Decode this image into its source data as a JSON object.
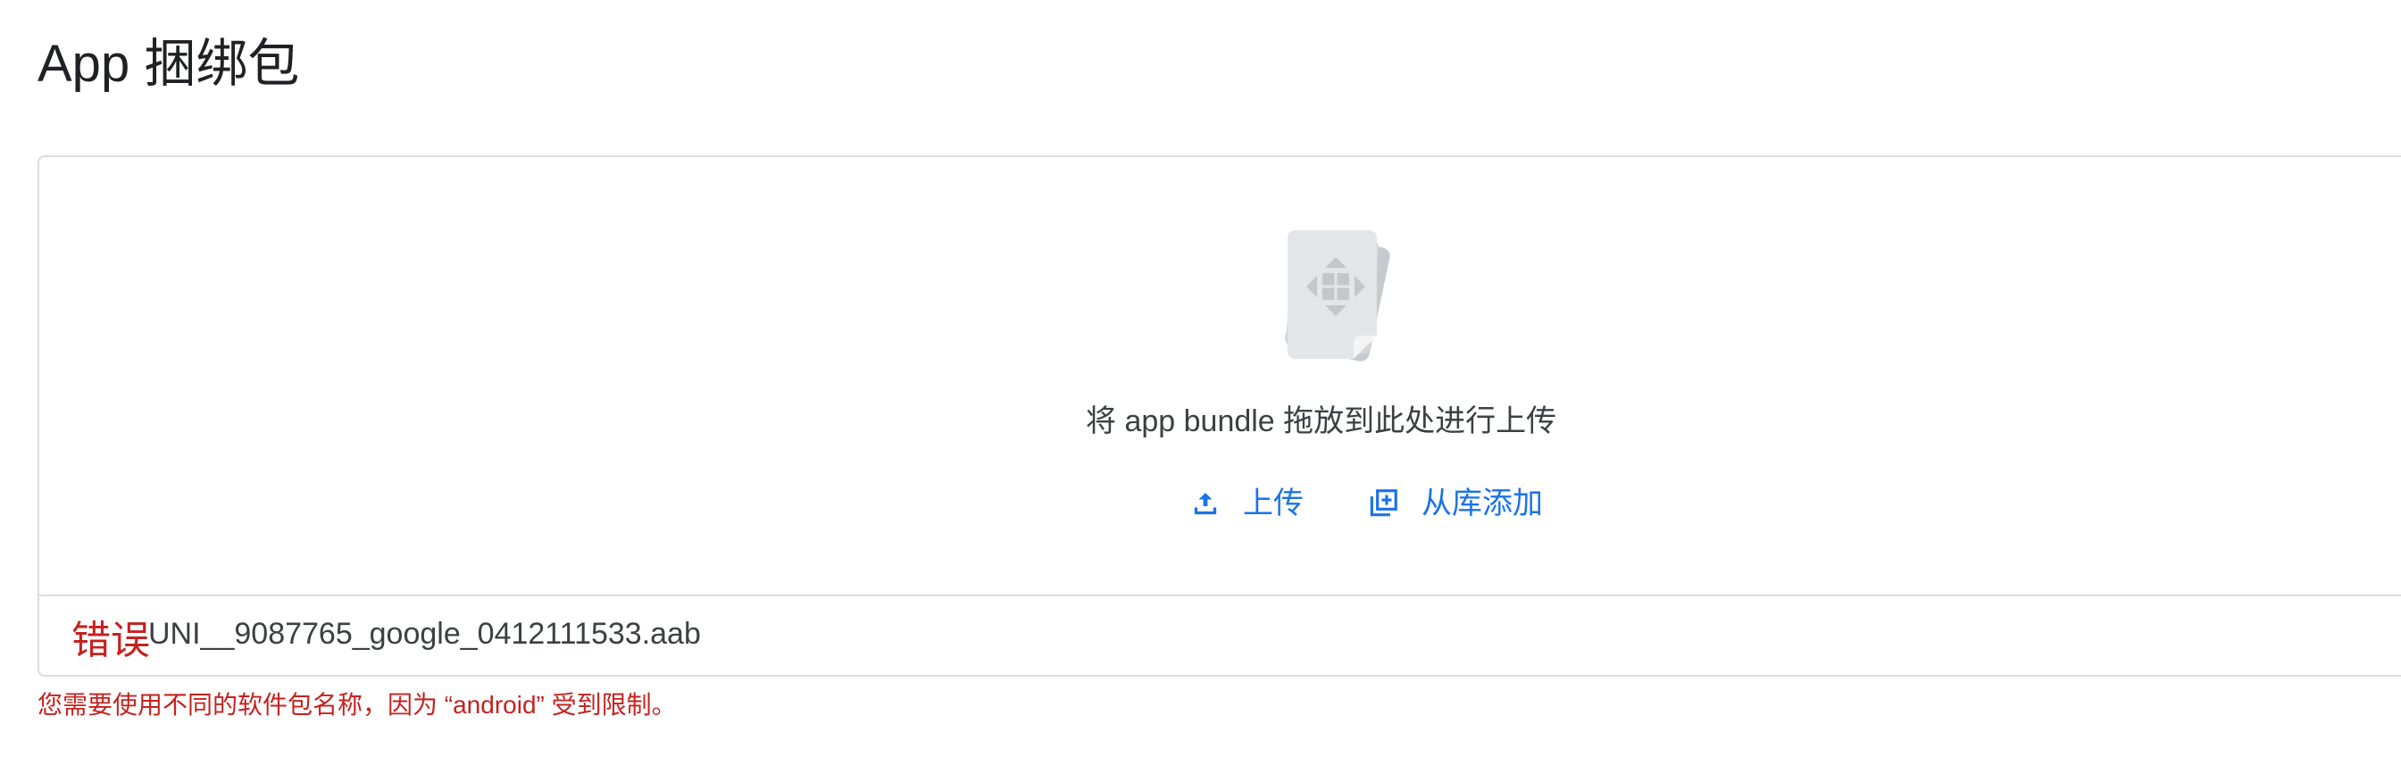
{
  "page": {
    "title": "App 捆绑包"
  },
  "dropzone": {
    "icon": "app-bundle-icon",
    "hint": "将 app bundle 拖放到此处进行上传",
    "actions": [
      {
        "label": "上传",
        "icon": "upload-icon"
      },
      {
        "label": "从库添加",
        "icon": "add-from-library-icon"
      }
    ]
  },
  "file": {
    "status_label": "错误",
    "name": "UNI__9087765_google_0412111533.aab"
  },
  "error": {
    "message": "您需要使用不同的软件包名称，因为 “android” 受到限制。"
  },
  "colors": {
    "accent": "#1a73e8",
    "error": "#c5221f",
    "border": "#dadce0",
    "text": "#202124"
  }
}
